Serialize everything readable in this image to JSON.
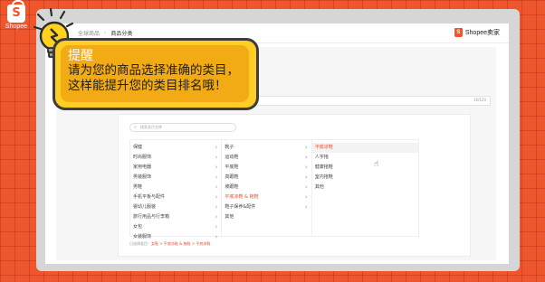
{
  "corner_logo": {
    "glyph": "S",
    "text": "Shopee"
  },
  "breadcrumb": {
    "parent": "全球商品",
    "current": "商品分类"
  },
  "brand": {
    "name": "Shopee卖家",
    "glyph": "S"
  },
  "name_field": {
    "counter": "16/120"
  },
  "search": {
    "placeholder": "搜索类目名称"
  },
  "columns": [
    {
      "items": [
        {
          "label": "保健",
          "arrow": true,
          "selected": false
        },
        {
          "label": "时尚服饰",
          "arrow": true,
          "selected": false
        },
        {
          "label": "家用电器",
          "arrow": true,
          "selected": false
        },
        {
          "label": "男装服饰",
          "arrow": true,
          "selected": false
        },
        {
          "label": "男鞋",
          "arrow": true,
          "selected": false
        },
        {
          "label": "手机平板与配件",
          "arrow": true,
          "selected": false
        },
        {
          "label": "婴幼儿服装",
          "arrow": true,
          "selected": false
        },
        {
          "label": "旅行用品与行李箱",
          "arrow": true,
          "selected": false
        },
        {
          "label": "女包",
          "arrow": true,
          "selected": false
        },
        {
          "label": "女装服饰",
          "arrow": true,
          "selected": false
        }
      ]
    },
    {
      "items": [
        {
          "label": "靴子",
          "arrow": true,
          "selected": false
        },
        {
          "label": "运动鞋",
          "arrow": true,
          "selected": false
        },
        {
          "label": "平底鞋",
          "arrow": true,
          "selected": false
        },
        {
          "label": "高跟鞋",
          "arrow": true,
          "selected": false
        },
        {
          "label": "坡跟鞋",
          "arrow": true,
          "selected": false
        },
        {
          "label": "平底凉鞋 & 拖鞋",
          "arrow": true,
          "selected": true
        },
        {
          "label": "鞋子保养&配件",
          "arrow": true,
          "selected": false
        },
        {
          "label": "其他",
          "arrow": false,
          "selected": false
        }
      ]
    },
    {
      "items": [
        {
          "label": "平底凉鞋",
          "arrow": false,
          "selected": true
        },
        {
          "label": "人字拖",
          "arrow": false,
          "selected": false
        },
        {
          "label": "健康拖鞋",
          "arrow": false,
          "selected": false
        },
        {
          "label": "室内拖鞋",
          "arrow": false,
          "selected": false
        },
        {
          "label": "其他",
          "arrow": false,
          "selected": false
        }
      ]
    }
  ],
  "selected_path": {
    "prefix": "已选择类目：",
    "value": "女鞋 > 平底凉鞋 & 拖鞋 > 平底凉鞋"
  },
  "tip": {
    "title": "提醒",
    "line1": "请为您的商品选择准确的类目，",
    "line2": "这样能提升您的类目排名哦！"
  },
  "colors": {
    "background": "#f0562d",
    "brand": "#ee4d2d",
    "tip_fill": "#ffce25",
    "tip_inner": "#f2ab14"
  },
  "icons": {
    "corner": "shopee-bag-icon",
    "bulb": "lightbulb-icon",
    "cursor": "hand-pointer-icon",
    "search": "search-icon",
    "arrow": "chevron-right-icon"
  }
}
